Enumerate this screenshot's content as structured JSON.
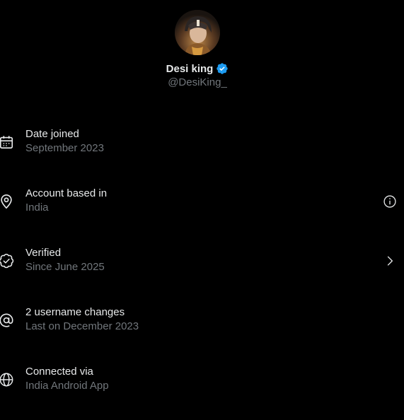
{
  "profile": {
    "display_name": "Desi king",
    "handle": "@DesiKing_",
    "avatar_icon": "profile-avatar",
    "verified_icon": "verified-badge-icon",
    "accent_color": "#1d9bf0"
  },
  "details": [
    {
      "label": "Date joined",
      "value": "September 2023",
      "icon": "calendar-icon"
    },
    {
      "label": "Account based in",
      "value": "India",
      "icon": "location-pin-icon",
      "trailing_icon": "info-icon"
    },
    {
      "label": "Verified",
      "value": "Since June 2025",
      "icon": "verified-check-icon",
      "trailing_icon": "chevron-right-icon"
    },
    {
      "label": "2 username changes",
      "value": "Last on December 2023",
      "icon": "at-sign-icon"
    },
    {
      "label": "Connected via",
      "value": "India Android App",
      "icon": "globe-icon"
    }
  ],
  "colors": {
    "background": "#000000",
    "primary_text": "#e7e9ea",
    "secondary_text": "#71767b",
    "icon": "#e7e9ea"
  }
}
